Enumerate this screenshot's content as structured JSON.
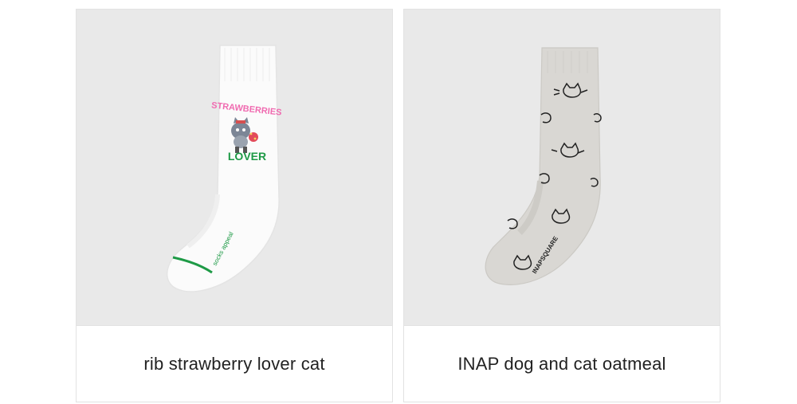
{
  "products": [
    {
      "name": "rib strawberry lover cat",
      "image_icon": "white-sock-image",
      "sock_text_top": "STRAWBERRIES",
      "sock_text_bottom": "LOVER",
      "sock_brand": "socks appeal",
      "accent_color": "#1e9a46"
    },
    {
      "name": "INAP dog and cat oatmeal",
      "image_icon": "oatmeal-sock-image",
      "sock_brand": "INAPSQUARE"
    }
  ],
  "colors": {
    "thumb_background": "#e9e9e9",
    "border": "#e2e2e2",
    "text": "#222222",
    "pink_lettering": "#f06ab0",
    "green_lettering": "#1e9a46",
    "oatmeal": "#d9d7d3"
  }
}
